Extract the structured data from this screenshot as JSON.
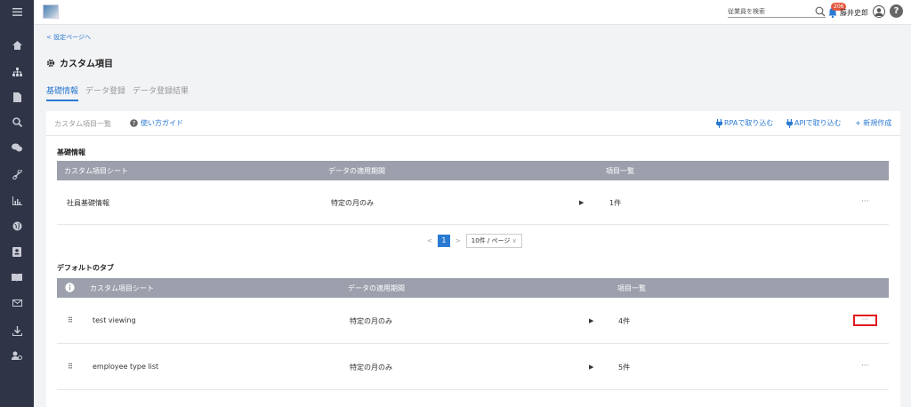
{
  "topbar": {
    "search_placeholder": "従業員を検索",
    "notification_count": "206",
    "user_name": "藤井史郎",
    "help_glyph": "?"
  },
  "back_link": "< 設定ページへ",
  "page_title": "カスタム項目",
  "tabs": [
    {
      "label": "基礎情報",
      "active": true
    },
    {
      "label": "データ登録",
      "active": false
    },
    {
      "label": "データ登録結果",
      "active": false
    }
  ],
  "panel": {
    "title": "カスタム項目一覧",
    "guide": "使い方ガイド",
    "rpa": "RPAで取り込む",
    "api": "APIで取り込む",
    "new": "+ 新規作成"
  },
  "basic_section": {
    "title": "基礎情報",
    "columns": [
      "カスタム項目シート",
      "データの適用期間",
      "項目一覧"
    ],
    "rows": [
      {
        "sheet": "社員基礎情報",
        "period": "特定の月のみ",
        "count": "1件"
      }
    ]
  },
  "pagination": {
    "prev": "<",
    "page": "1",
    "next": ">",
    "page_size": "10件 / ページ"
  },
  "default_section": {
    "title": "デフォルトのタブ",
    "columns": [
      "カスタム項目シート",
      "データの適用期間",
      "項目一覧"
    ],
    "rows": [
      {
        "sheet": "test viewing",
        "period": "特定の月のみ",
        "count": "4件"
      },
      {
        "sheet": "employee type list",
        "period": "特定の月のみ",
        "count": "5件"
      }
    ]
  },
  "row_more": "···",
  "caret": "▶",
  "drag_handle": "⠿",
  "icons": {
    "menu": "hamburger-icon",
    "home": "home-icon",
    "org": "org-chart-icon",
    "doc": "document-icon",
    "search": "search-icon",
    "chat": "chat-icon",
    "link": "link-icon",
    "chart": "chart-icon",
    "globe": "globe-icon",
    "id": "id-card-icon",
    "book": "book-icon",
    "mail": "mail-icon",
    "download": "download-icon",
    "user-settings": "user-settings-icon"
  },
  "colors": {
    "accent": "#2a7ad2",
    "sidebar": "#2f3447",
    "header": "#9ba0ac",
    "highlight": "#e0191f",
    "badge": "#e4583e"
  }
}
